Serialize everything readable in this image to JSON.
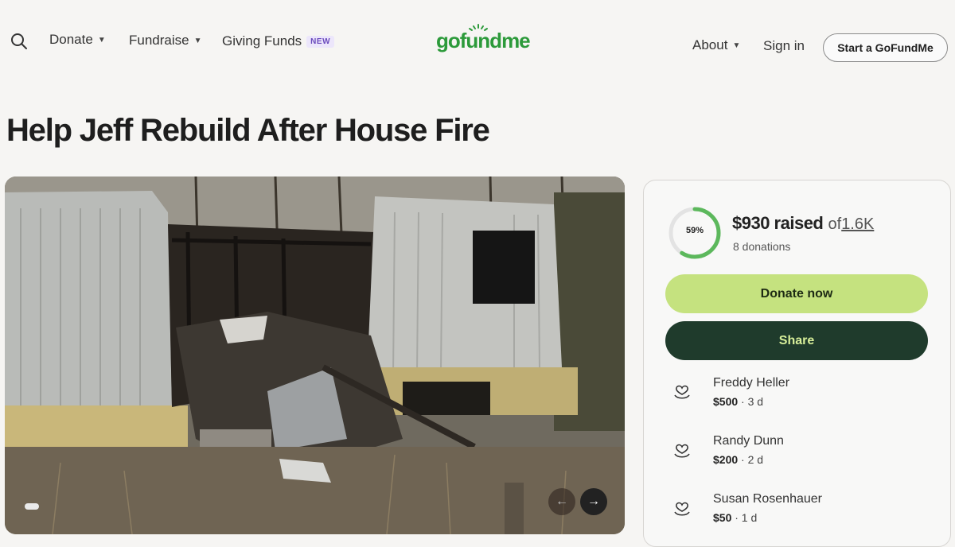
{
  "nav": {
    "donate": "Donate",
    "fundraise": "Fundraise",
    "giving_funds": "Giving Funds",
    "new_badge": "NEW",
    "logo": "gofundme",
    "about": "About",
    "sign_in": "Sign in",
    "start": "Start a GoFundMe"
  },
  "campaign": {
    "title": "Help Jeff Rebuild After House Fire"
  },
  "progress": {
    "percent_label": "59%",
    "fraction": 0.59,
    "raised": "$930 raised",
    "of_label": "of",
    "goal": "1.6K",
    "donations": "8 donations"
  },
  "actions": {
    "donate_now": "Donate now",
    "share": "Share"
  },
  "donors": [
    {
      "name": "Freddy Heller",
      "amount": "$500",
      "time": "· 3 d"
    },
    {
      "name": "Randy Dunn",
      "amount": "$200",
      "time": "· 2 d"
    },
    {
      "name": "Susan Rosenhauer",
      "amount": "$50",
      "time": "· 1 d"
    }
  ],
  "colors": {
    "brand_green": "#2c9a3a",
    "donate_button": "#c5e27f",
    "share_button": "#1f3b2c",
    "progress_ring": "#5cb85c"
  },
  "icons": [
    "search-icon",
    "chevron-down-icon",
    "arrow-left-icon",
    "arrow-right-icon",
    "heart-hand-icon"
  ]
}
